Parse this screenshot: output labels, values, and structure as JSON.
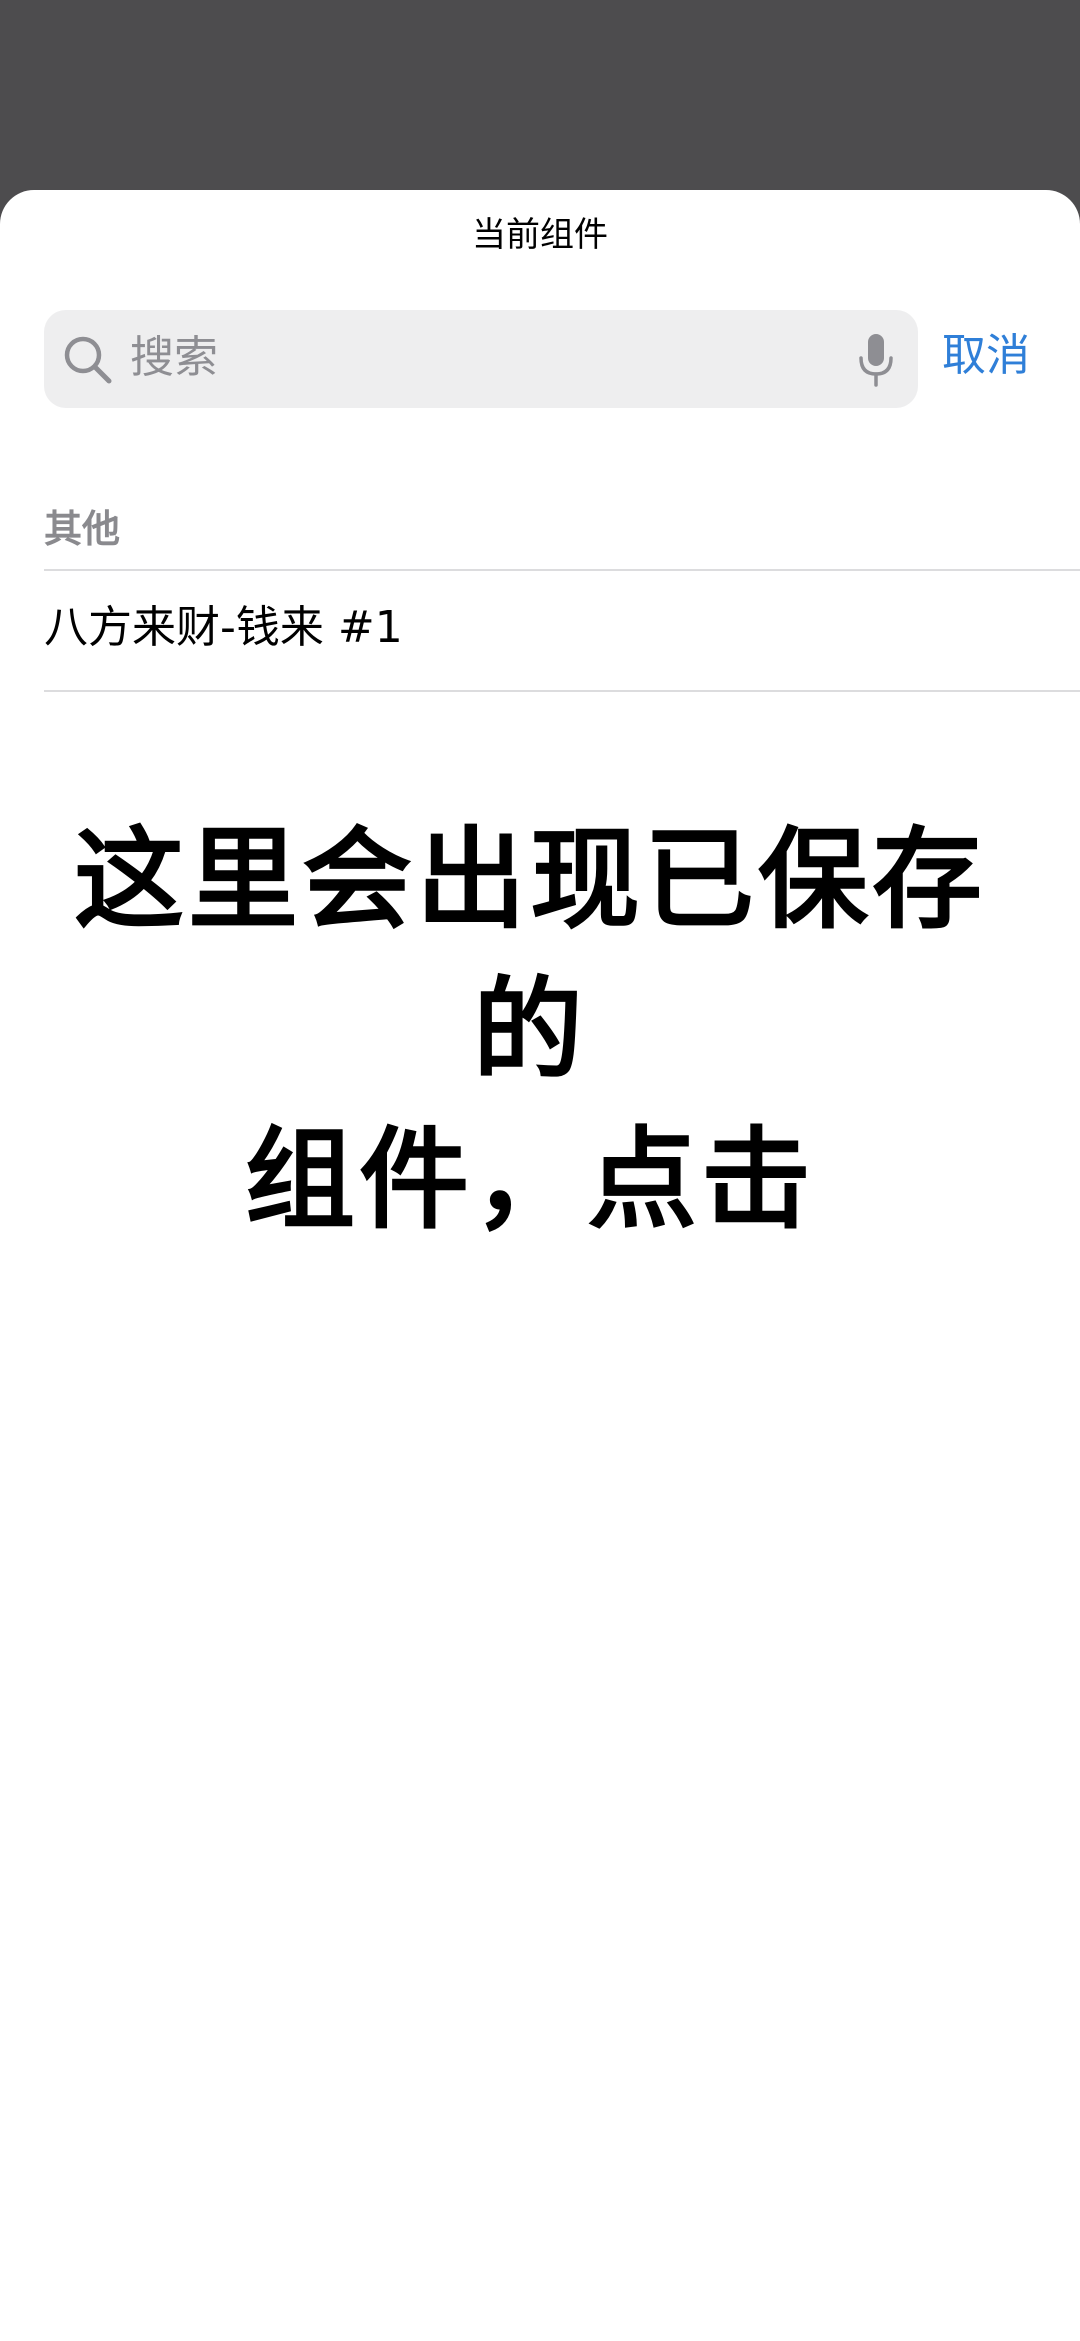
{
  "sheet": {
    "title": "当前组件"
  },
  "search": {
    "placeholder": "搜索",
    "search_icon": "search-icon",
    "mic_icon": "microphone-icon",
    "cancel_label": "取消"
  },
  "section": {
    "header": "其他",
    "items": [
      {
        "label": "八方来财-钱来 #1"
      }
    ]
  },
  "overlay_caption": {
    "line1": "这里会出现已保存的",
    "line2": "组件，点击"
  },
  "colors": {
    "backdrop": "#4d4c4e",
    "accent": "#2f7fd8",
    "search_bg": "#eeeeef",
    "secondary_text": "#8e8e93"
  }
}
